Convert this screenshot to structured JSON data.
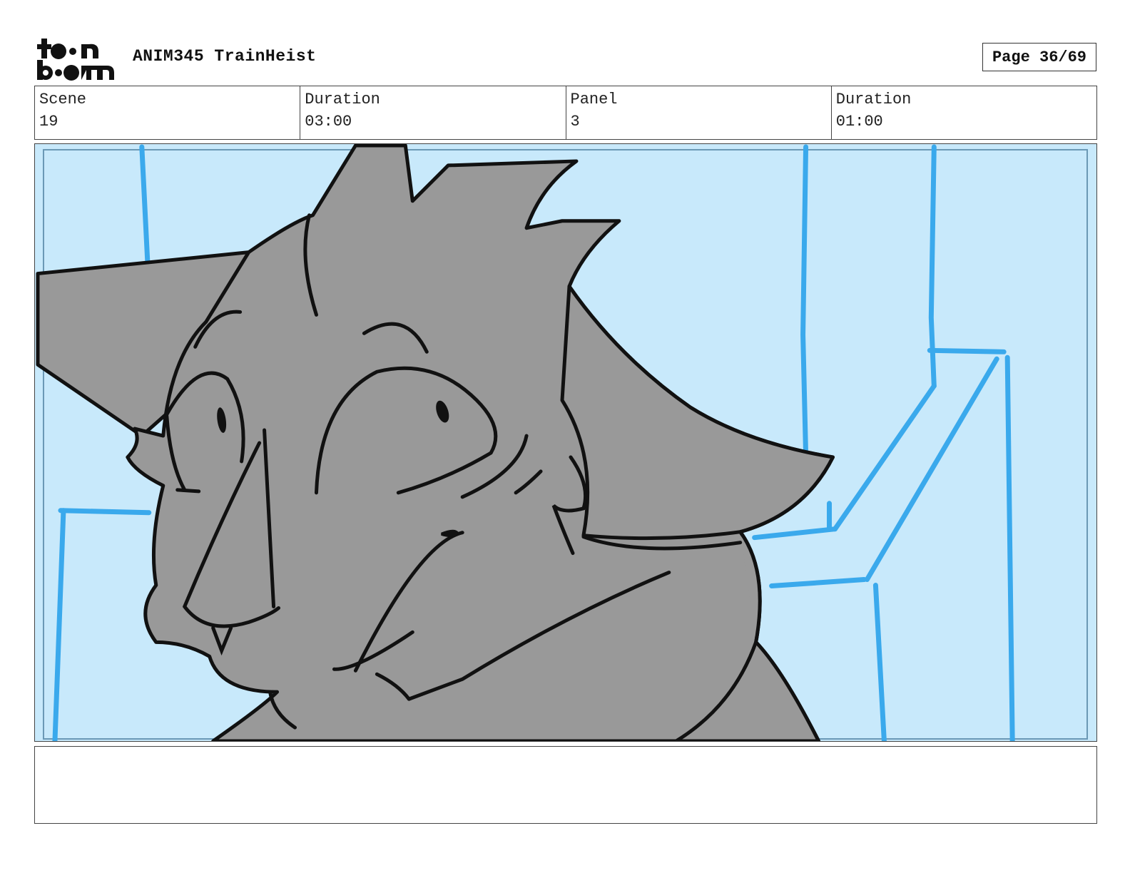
{
  "header": {
    "logo_alt": "toon boom",
    "project_title": "ANIM345 TrainHeist",
    "page_label": "Page 36/69"
  },
  "info": [
    {
      "label": "Scene",
      "value": "19"
    },
    {
      "label": "Duration",
      "value": "03:00"
    },
    {
      "label": "Panel",
      "value": "3"
    },
    {
      "label": "Duration",
      "value": "01:00"
    }
  ],
  "panel": {
    "background_color": "#c8e9fb",
    "line_color": "#3aa9ec",
    "character_fill": "#999999",
    "ink_color": "#111111"
  },
  "notes": {
    "text": ""
  }
}
